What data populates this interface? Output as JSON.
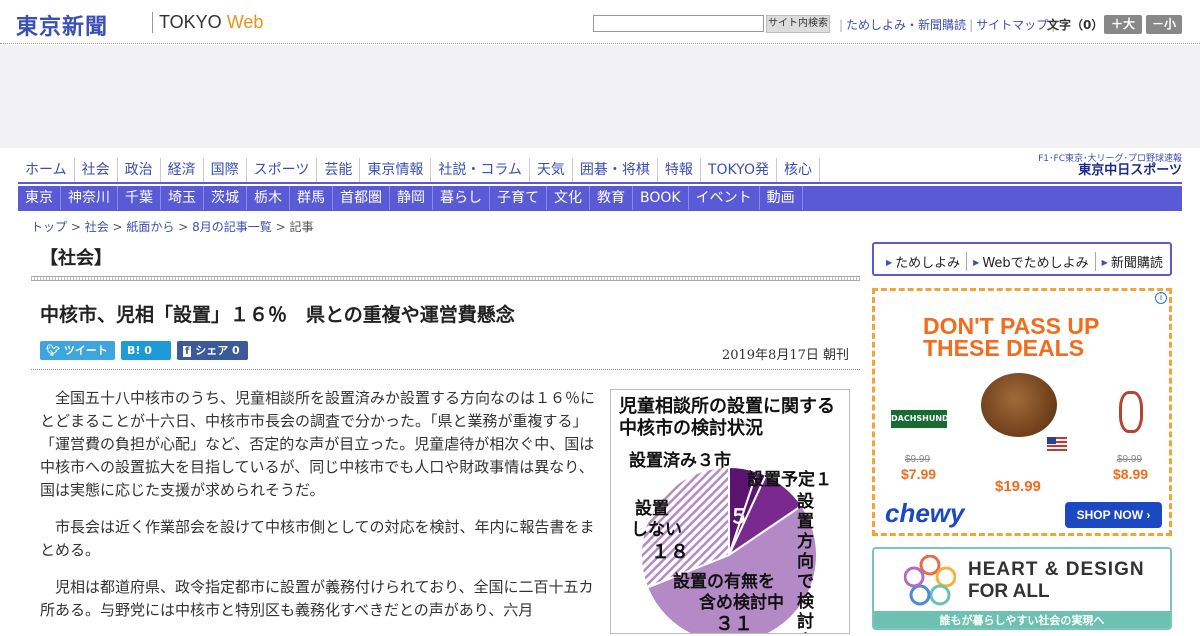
{
  "header": {
    "logo_jp": "東京新聞",
    "logo_en_a": "TOKYO",
    "logo_en_b": "Web",
    "search_button": "サイト内検索",
    "links": [
      "ためしよみ・新聞購読",
      "サイトマップ"
    ],
    "font_size_label": "文字（0）",
    "font_plus": "＋大",
    "font_minus": "－小"
  },
  "nav_primary": [
    "ホーム",
    "社会",
    "政治",
    "経済",
    "国際",
    "スポーツ",
    "芸能",
    "東京情報",
    "社説・コラム",
    "天気",
    "囲碁・将棋",
    "特報",
    "TOKYO発",
    "核心"
  ],
  "chunichi": {
    "line1": "F1･FC東京･大リーグ･プロ野球速報",
    "line2": "東京中日スポーツ"
  },
  "nav_secondary": [
    "東京",
    "神奈川",
    "千葉",
    "埼玉",
    "茨城",
    "栃木",
    "群馬",
    "首都圏",
    "静岡",
    "暮らし",
    "子育て",
    "文化",
    "教育",
    "BOOK",
    "イベント",
    "動画"
  ],
  "breadcrumb": {
    "items": [
      "トップ",
      "社会",
      "紙面から",
      "8月の記事一覧"
    ],
    "current": "記事",
    "sep": " > "
  },
  "section_title": "【社会】",
  "article": {
    "headline": "中核市、児相「設置」１６％　県との重複や運営費懸念",
    "tweet": "ツイート",
    "hatena_count": "0",
    "share_label": "シェア",
    "share_count": "0",
    "date": "2019年8月17日 朝刊",
    "paragraphs": [
      "全国五十八中核市のうち、児童相談所を設置済みか設置する方向なのは１６％にとどまることが十六日、中核市市長会の調査で分かった。「県と業務が重複する」「運営費の負担が心配」など、否定的な声が目立った。児童虐待が相次ぐ中、国は中核市への設置拡大を目指しているが、同じ中核市でも人口や財政事情は異なり、国は実態に応じた支援が求められそうだ。",
      "市長会は近く作業部会を設けて中核市側としての対応を検討、年内に報告書をまとめる。",
      "児相は都道府県、政令指定都市に設置が義務付けられており、全国に二百十五カ所ある。与野党には中核市と特別区も義務化すべきだとの声があり、六月"
    ]
  },
  "figure": {
    "title": "児童相談所の設置に関する中核市の検討状況",
    "chart_data": {
      "type": "pie",
      "title": "児童相談所の設置に関する中核市の検討状況",
      "categories": [
        "設置済み",
        "設置予定",
        "設置方向で検討中",
        "設置の有無を含め検討中",
        "設置しない"
      ],
      "values": [
        3,
        1,
        5,
        31,
        18
      ],
      "colors": [
        "#5b1570",
        "#5b1570",
        "#7a2a8e",
        "#b48ac6",
        "#ffffff"
      ]
    },
    "labels": {
      "done": "設置済み３市",
      "planned": "設置予定１",
      "direction": "設置方向で検討中",
      "direction_val": "５",
      "undecided_a": "設置の有無を",
      "undecided_b": "含め検討中",
      "undecided_val": "３１",
      "no_a": "設置",
      "no_b": "しない",
      "no_val": "１８"
    }
  },
  "sidebar": {
    "buttons": [
      "ためしよみ",
      "Webでためしよみ",
      "新聞購読"
    ],
    "ad": {
      "line1": "DON'T PASS UP",
      "line2": "THESE DEALS",
      "tag": "DACHSHUND",
      "old_left": "$9.99",
      "price_left": "$7.99",
      "price_center": "$19.99",
      "old_right": "$9.99",
      "price_right": "$8.99",
      "brand": "chewy",
      "cta": "SHOP NOW ›"
    },
    "banner": {
      "line1": "HEART & DESIGN",
      "line2": "FOR ALL",
      "line3": "誰もが暮らしやすい社会の実現へ"
    }
  }
}
